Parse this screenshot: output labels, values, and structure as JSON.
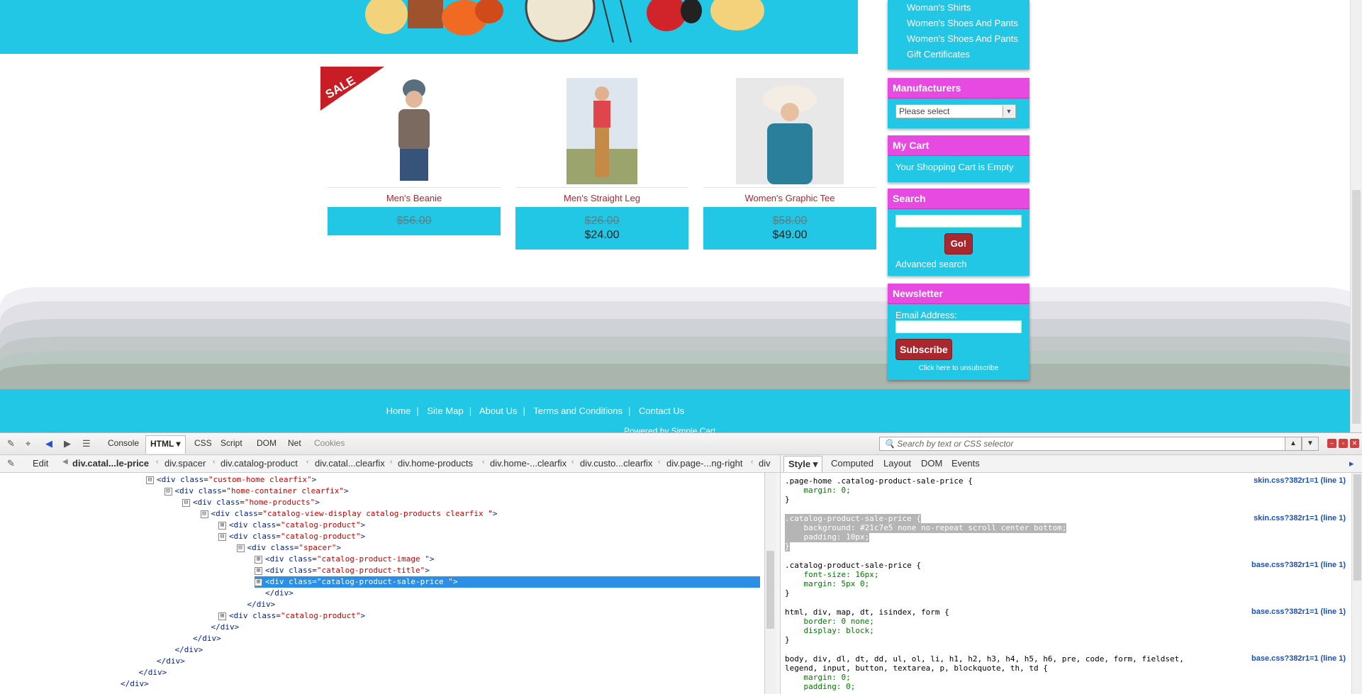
{
  "sidebar": {
    "categories": [
      "Woman's Shirts",
      "Women's Shoes And Pants",
      "Women's Shoes And Pants",
      "Gift Certificates"
    ],
    "manufacturers": {
      "title": "Manufacturers",
      "select_value": "Please select"
    },
    "cart": {
      "title": "My Cart",
      "text": "Your Shopping Cart is Empty"
    },
    "search": {
      "title": "Search",
      "button": "Go!",
      "advanced": "Advanced search"
    },
    "newsletter": {
      "title": "Newsletter",
      "label": "Email Address:",
      "button": "Subscribe",
      "unsubscribe": "Click here to unsubscribe"
    }
  },
  "products": [
    {
      "title": "Men's Beanie",
      "old_price": "$56.00",
      "new_price": "",
      "sale_badge": "SALE"
    },
    {
      "title": "Men's Straight Leg",
      "old_price": "$26.00",
      "new_price": "$24.00"
    },
    {
      "title": "Women's Graphic Tee",
      "old_price": "$58.00",
      "new_price": "$49.00"
    }
  ],
  "footer": {
    "links": [
      "Home",
      "Site Map",
      "About Us",
      "Terms and Conditions",
      "Contact Us"
    ],
    "cut_text": "Powered by Simple Cart"
  },
  "devtools": {
    "tabs": [
      "Console",
      "HTML",
      "CSS",
      "Script",
      "DOM",
      "Net",
      "Cookies"
    ],
    "search_placeholder": "Search by text or CSS selector",
    "edit": "Edit",
    "breadcrumbs": [
      "div.catal...le-price",
      "div.spacer",
      "div.catalog-product",
      "div.catal...clearfix",
      "div.home-products",
      "div.home-...clearfix",
      "div.custo...clearfix",
      "div.page-...ng-right",
      "div"
    ],
    "side_tabs": [
      "Style",
      "Computed",
      "Layout",
      "DOM",
      "Events"
    ],
    "tree": [
      {
        "indent": 0,
        "toggle": "⊟",
        "open": "<div ",
        "attr": "class=",
        "val": "\"custom-home clearfix\"",
        "close": ">"
      },
      {
        "indent": 1,
        "toggle": "⊟",
        "open": "<div ",
        "attr": "class=",
        "val": "\"home-container clearfix\"",
        "close": ">"
      },
      {
        "indent": 2,
        "toggle": "⊟",
        "open": "<div ",
        "attr": "class=",
        "val": "\"home-products\"",
        "close": ">"
      },
      {
        "indent": 3,
        "toggle": "⊟",
        "open": "<div ",
        "attr": "class=",
        "val": "\"catalog-view-display catalog-products clearfix \"",
        "close": ">"
      },
      {
        "indent": 4,
        "toggle": "⊞",
        "open": "<div ",
        "attr": "class=",
        "val": "\"catalog-product\"",
        "close": ">"
      },
      {
        "indent": 4,
        "toggle": "⊟",
        "open": "<div ",
        "attr": "class=",
        "val": "\"catalog-product\"",
        "close": ">"
      },
      {
        "indent": 5,
        "toggle": "⊟",
        "open": "<div ",
        "attr": "class=",
        "val": "\"spacer\"",
        "close": ">"
      },
      {
        "indent": 6,
        "toggle": "⊞",
        "open": "<div ",
        "attr": "class=",
        "val": "\"catalog-product-image \"",
        "close": ">"
      },
      {
        "indent": 6,
        "toggle": "⊞",
        "open": "<div ",
        "attr": "class=",
        "val": "\"catalog-product-title\"",
        "close": ">"
      },
      {
        "indent": 6,
        "toggle": "⊞",
        "open": "<div ",
        "attr": "class=",
        "val": "\"catalog-product-sale-price \"",
        "close": ">",
        "selected": true
      },
      {
        "indent": 6,
        "toggle": "",
        "open": "</div>",
        "attr": "",
        "val": "",
        "close": ""
      },
      {
        "indent": 5,
        "toggle": "",
        "open": "</div>",
        "attr": "",
        "val": "",
        "close": ""
      },
      {
        "indent": 4,
        "toggle": "⊞",
        "open": "<div ",
        "attr": "class=",
        "val": "\"catalog-product\"",
        "close": ">"
      },
      {
        "indent": 3,
        "toggle": "",
        "open": "</div>",
        "attr": "",
        "val": "",
        "close": ""
      },
      {
        "indent": 2,
        "toggle": "",
        "open": "</div>",
        "attr": "",
        "val": "",
        "close": ""
      },
      {
        "indent": 1,
        "toggle": "",
        "open": "</div>",
        "attr": "",
        "val": "",
        "close": ""
      },
      {
        "indent": 0,
        "toggle": "",
        "open": "</div>",
        "attr": "",
        "val": "",
        "close": ""
      },
      {
        "indent": -1,
        "toggle": "",
        "open": "</div>",
        "attr": "",
        "val": "",
        "close": ""
      },
      {
        "indent": -2,
        "toggle": "",
        "open": "</div>",
        "attr": "",
        "val": "",
        "close": ""
      }
    ],
    "css_rules": [
      {
        "lines": [
          ".page-home .catalog-product-sale-price {",
          "    margin: 0;",
          "}"
        ],
        "src": "skin.css?382r1=1 (line 1)"
      },
      {
        "lines": [
          ".catalog-product-sale-price {",
          "    background: #21c7e5 none no-repeat scroll center bottom;",
          "    padding: 10px;",
          "}"
        ],
        "src": "skin.css?382r1=1 (line 1)",
        "highlight": true
      },
      {
        "lines": [
          ".catalog-product-sale-price {",
          "    font-size: 16px;",
          "    margin: 5px 0;",
          "}"
        ],
        "src": "base.css?382r1=1 (line 1)"
      },
      {
        "lines": [
          "html, div, map, dt, isindex, form {",
          "    border: 0 none;",
          "    display: block;",
          "}"
        ],
        "src": "base.css?382r1=1 (line 1)"
      },
      {
        "lines": [
          "body, div, dl, dt, dd, ul, ol, li, h1, h2, h3, h4, h5, h6, pre, code, form, fieldset,",
          "legend, input, button, textarea, p, blockquote, th, td {",
          "    margin: 0;",
          "    padding: 0;"
        ],
        "src": "base.css?382r1=1 (line 1)"
      }
    ]
  }
}
